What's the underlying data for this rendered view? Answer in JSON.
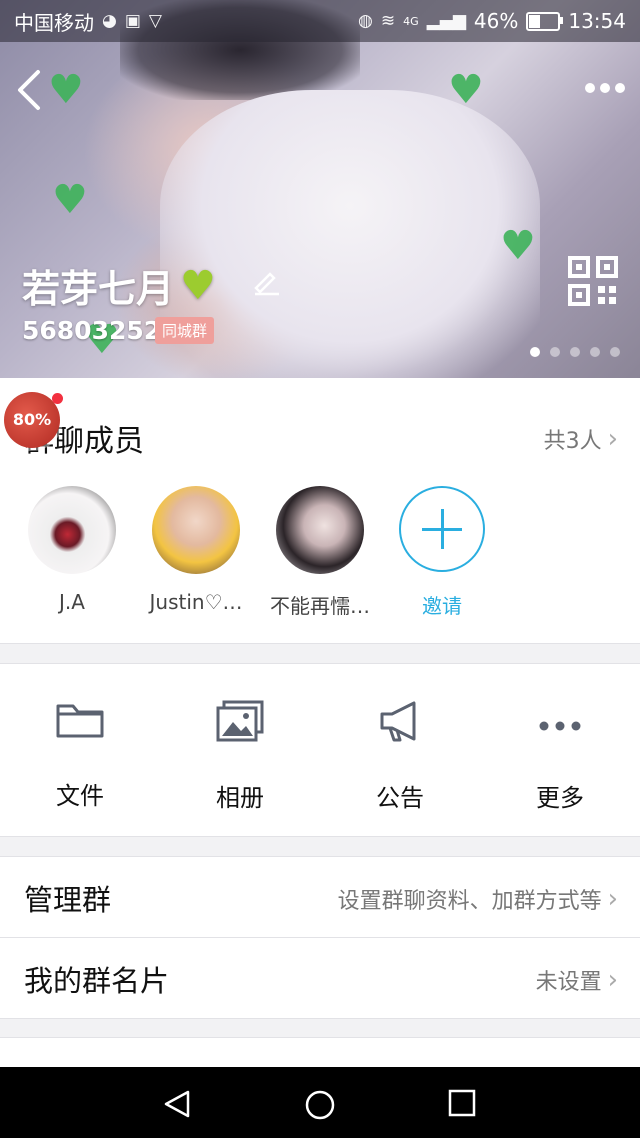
{
  "status_bar": {
    "carrier": "中国移动",
    "battery_percent": "46%",
    "time": "13:54",
    "network_label": "4G",
    "battery_level": 0.46
  },
  "header": {
    "group_name": "若芽七月",
    "group_id": "568032526",
    "badge": "同城群",
    "carousel_total": 5,
    "carousel_active": 1
  },
  "floating_badge": {
    "text": "80%"
  },
  "members": {
    "title": "群聊成员",
    "count": "共3人",
    "list": [
      {
        "name": "J.A"
      },
      {
        "name": "Justin♡…"
      },
      {
        "name": "不能再懦…"
      }
    ],
    "invite_label": "邀请"
  },
  "features": [
    {
      "label": "文件",
      "icon": "folder-icon"
    },
    {
      "label": "相册",
      "icon": "album-icon"
    },
    {
      "label": "公告",
      "icon": "megaphone-icon"
    },
    {
      "label": "更多",
      "icon": "more-icon"
    }
  ],
  "settings": {
    "manage_group": {
      "label": "管理群",
      "value": "设置群聊资料、加群方式等"
    },
    "my_card": {
      "label": "我的群名片",
      "value": "未设置"
    }
  },
  "colors": {
    "accent": "#2aaee0",
    "heart": "#9ccc2f",
    "badge": "#ef9f9b"
  }
}
